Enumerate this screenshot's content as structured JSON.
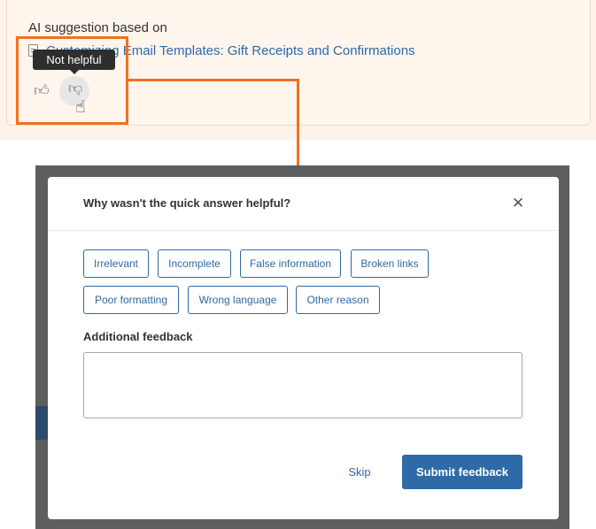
{
  "suggestion": {
    "intro": "AI suggestion based on",
    "article_link": "Customizing Email Templates: Gift Receipts and Confirmations",
    "tooltip": "Not helpful",
    "thumbs_up_icon": "thumbs-up-icon",
    "thumbs_down_icon": "thumbs-down-icon",
    "cursor_icon": "hand-pointer-icon",
    "accent": "#f27020"
  },
  "modal": {
    "title": "Why wasn't the quick answer helpful?",
    "close_icon": "close-icon",
    "reasons": [
      "Irrelevant",
      "Incomplete",
      "False information",
      "Broken links",
      "Poor formatting",
      "Wrong language",
      "Other reason"
    ],
    "feedback_label": "Additional feedback",
    "feedback_value": "",
    "skip_label": "Skip",
    "submit_label": "Submit feedback",
    "primary_color": "#2e6aa8"
  }
}
